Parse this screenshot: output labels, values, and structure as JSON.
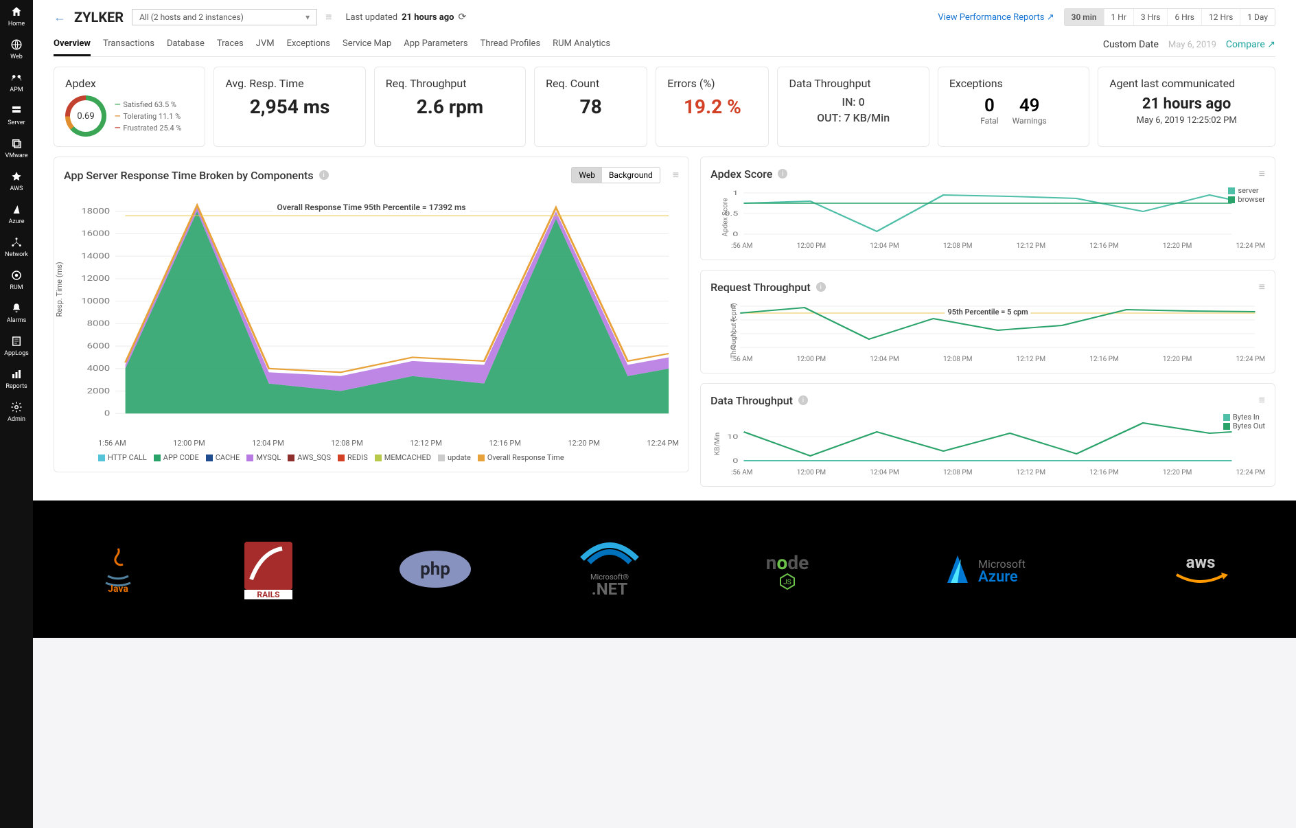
{
  "sidebar": {
    "items": [
      {
        "label": "Home",
        "icon": "home"
      },
      {
        "label": "Web",
        "icon": "globe"
      },
      {
        "label": "APM",
        "icon": "apm"
      },
      {
        "label": "Server",
        "icon": "server"
      },
      {
        "label": "VMware",
        "icon": "vmware"
      },
      {
        "label": "AWS",
        "icon": "aws"
      },
      {
        "label": "Azure",
        "icon": "azure"
      },
      {
        "label": "Network",
        "icon": "network"
      },
      {
        "label": "RUM",
        "icon": "rum"
      },
      {
        "label": "Alarms",
        "icon": "bell"
      },
      {
        "label": "AppLogs",
        "icon": "applogs"
      },
      {
        "label": "Reports",
        "icon": "reports"
      },
      {
        "label": "Admin",
        "icon": "gear"
      }
    ]
  },
  "header": {
    "app_name": "ZYLKER",
    "host_selector": "All (2 hosts and 2 instances)",
    "last_updated_prefix": "Last updated",
    "last_updated_value": "21 hours ago",
    "view_reports": "View Performance Reports",
    "time_ranges": [
      "30 min",
      "1 Hr",
      "3 Hrs",
      "6 Hrs",
      "12 Hrs",
      "1 Day"
    ],
    "active_range": "30 min"
  },
  "tabs": {
    "items": [
      "Overview",
      "Transactions",
      "Database",
      "Traces",
      "JVM",
      "Exceptions",
      "Service Map",
      "App Parameters",
      "Thread Profiles",
      "RUM Analytics"
    ],
    "active": "Overview",
    "custom_date_label": "Custom Date",
    "date_value": "May 6, 2019",
    "compare": "Compare"
  },
  "kpi": {
    "apdex": {
      "title": "Apdex",
      "score": "0.69",
      "satisfied": "Satisfied  63.5 %",
      "tolerating": "Tolerating  11.1 %",
      "frustrated": "Frustrated  25.4 %"
    },
    "avg_resp": {
      "title": "Avg. Resp. Time",
      "value": "2,954 ms"
    },
    "req_throughput": {
      "title": "Req. Throughput",
      "value": "2.6 rpm"
    },
    "req_count": {
      "title": "Req. Count",
      "value": "78"
    },
    "errors": {
      "title": "Errors (%)",
      "value": "19.2 %"
    },
    "data_throughput": {
      "title": "Data Throughput",
      "in": "IN: 0",
      "out": "OUT: 7 KB/Min"
    },
    "exceptions": {
      "title": "Exceptions",
      "fatal": "0",
      "fatal_label": "Fatal",
      "warnings": "49",
      "warnings_label": "Warnings"
    },
    "agent": {
      "title": "Agent last communicated",
      "value": "21 hours ago",
      "ts": "May 6, 2019 12:25:02 PM"
    }
  },
  "panels": {
    "response_time": {
      "title": "App Server Response Time Broken by Components",
      "toggle": {
        "web": "Web",
        "bg": "Background"
      },
      "overall_label": "Overall Response Time 95th Percentile = 17392 ms"
    },
    "apdex_score": {
      "title": "Apdex Score"
    },
    "req_throughput": {
      "title": "Request Throughput",
      "pct95": "95th Percentile = 5 cpm"
    },
    "data_throughput": {
      "title": "Data Throughput"
    }
  },
  "chart_data": [
    {
      "id": "response_time",
      "type": "area",
      "title": "App Server Response Time Broken by Components",
      "ylabel": "Resp. Time (ms)",
      "ylim": [
        0,
        18000
      ],
      "y_ticks": [
        0,
        2000,
        4000,
        6000,
        8000,
        10000,
        12000,
        14000,
        16000,
        18000
      ],
      "categories": [
        "1:56 AM",
        "12:00 PM",
        "12:04 PM",
        "12:08 PM",
        "12:12 PM",
        "12:16 PM",
        "12:20 PM",
        "12:24 PM"
      ],
      "series": [
        {
          "name": "HTTP CALL",
          "color": "#55c4d9",
          "values": [
            200,
            300,
            200,
            400,
            300,
            500,
            400,
            300
          ]
        },
        {
          "name": "APP CODE",
          "color": "#2aa36a",
          "values": [
            3500,
            15000,
            2500,
            1800,
            3000,
            2000,
            14000,
            3500
          ]
        },
        {
          "name": "CACHE",
          "color": "#1f4b8f",
          "values": [
            100,
            100,
            100,
            100,
            100,
            100,
            100,
            100
          ]
        },
        {
          "name": "MYSQL",
          "color": "#b77ae2",
          "values": [
            300,
            2500,
            1200,
            1500,
            1600,
            2000,
            3000,
            1200
          ]
        },
        {
          "name": "AWS_SQS",
          "color": "#8e2e2e",
          "values": [
            50,
            50,
            50,
            50,
            50,
            50,
            50,
            50
          ]
        },
        {
          "name": "REDIS",
          "color": "#d24126",
          "values": [
            50,
            50,
            50,
            50,
            50,
            50,
            50,
            50
          ]
        },
        {
          "name": "MEMCACHED",
          "color": "#b8c94a",
          "values": [
            50,
            50,
            50,
            50,
            50,
            50,
            50,
            50
          ]
        },
        {
          "name": "update",
          "color": "#cccccc",
          "values": [
            50,
            50,
            50,
            50,
            50,
            50,
            50,
            50
          ]
        },
        {
          "name": "Overall Response Time",
          "color": "#e8a23a",
          "values": [
            4300,
            18100,
            4150,
            3950,
            5150,
            4750,
            17700,
            5250
          ]
        }
      ],
      "percentile_95": 17392
    },
    {
      "id": "apdex_score",
      "type": "line",
      "title": "Apdex Score",
      "ylabel": "Apdex Score",
      "ylim": [
        0,
        1
      ],
      "y_ticks": [
        0,
        0.5,
        1
      ],
      "categories": [
        ":56 AM",
        "12:00 PM",
        "12:04 PM",
        "12:08 PM",
        "12:12 PM",
        "12:16 PM",
        "12:20 PM",
        "12:24 PM"
      ],
      "series": [
        {
          "name": "server",
          "color": "#4fbfa8",
          "values": [
            0.75,
            0.8,
            0.1,
            0.95,
            0.92,
            0.85,
            0.55,
            0.95
          ]
        },
        {
          "name": "browser",
          "color": "#2aa36a",
          "values": [
            0.75,
            0.75,
            0.75,
            0.75,
            0.75,
            0.75,
            0.75,
            0.75
          ]
        }
      ]
    },
    {
      "id": "request_throughput",
      "type": "line",
      "title": "Request Throughput",
      "ylabel": "Throughput (cpm)",
      "ylim": [
        0,
        6
      ],
      "y_ticks": [
        0,
        2,
        4,
        6
      ],
      "categories": [
        ":56 AM",
        "12:00 PM",
        "12:04 PM",
        "12:08 PM",
        "12:12 PM",
        "12:16 PM",
        "12:20 PM",
        "12:24 PM"
      ],
      "series": [
        {
          "name": "throughput",
          "color": "#2aa36a",
          "values": [
            5,
            5.8,
            1.2,
            4.2,
            2.5,
            3.2,
            5.5,
            5.3
          ]
        }
      ],
      "percentile_95": 5
    },
    {
      "id": "data_throughput",
      "type": "line",
      "title": "Data Throughput",
      "ylabel": "KB/Min",
      "ylim": [
        0,
        20
      ],
      "y_ticks": [
        0,
        10
      ],
      "categories": [
        ":56 AM",
        "12:00 PM",
        "12:04 PM",
        "12:08 PM",
        "12:12 PM",
        "12:16 PM",
        "12:20 PM",
        "12:24 PM"
      ],
      "series": [
        {
          "name": "Bytes In",
          "color": "#4fbfa8",
          "values": [
            0,
            0,
            0,
            0,
            0,
            0,
            0,
            0
          ]
        },
        {
          "name": "Bytes Out",
          "color": "#2aa36a",
          "values": [
            12,
            2,
            12,
            4,
            11,
            3,
            16,
            13
          ]
        }
      ]
    }
  ],
  "footer_logos": [
    "Java",
    "Rails",
    "php",
    ".NET",
    "node",
    "Microsoft Azure",
    "aws"
  ]
}
